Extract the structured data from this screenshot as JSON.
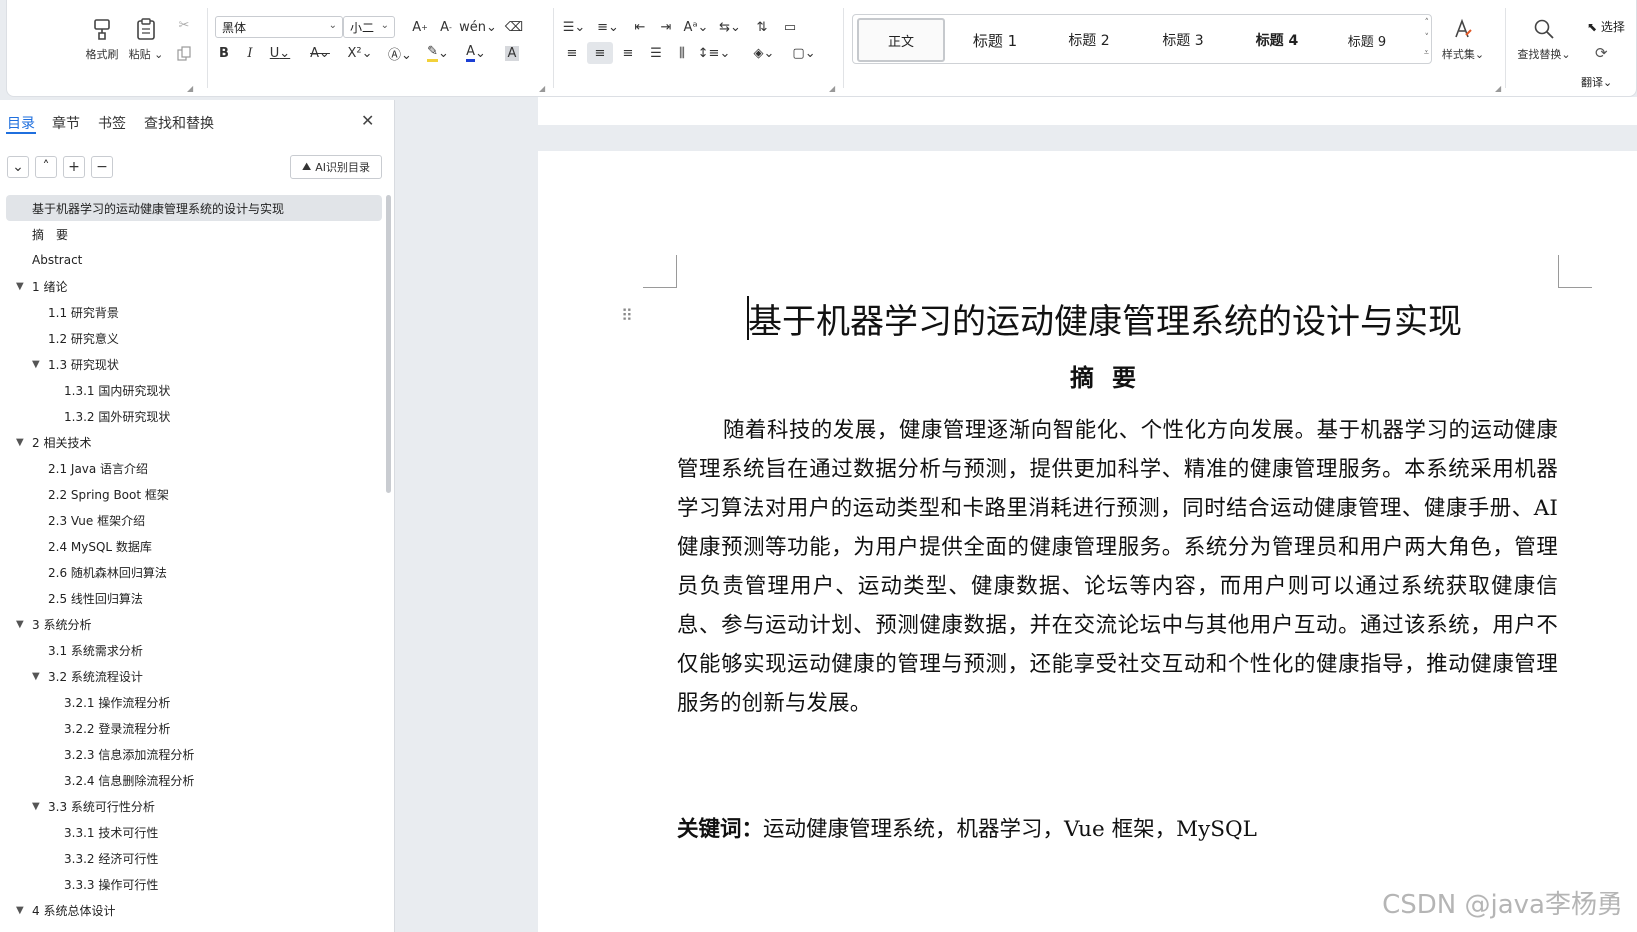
{
  "ribbon": {
    "format_painter": "格式刷",
    "paste": "粘贴",
    "font_name": "黑体",
    "font_size": "小二",
    "styles": [
      {
        "label": "正文"
      },
      {
        "label": "标题 1"
      },
      {
        "label": "标题 2"
      },
      {
        "label": "标题 3"
      },
      {
        "label": "标题 4"
      },
      {
        "label": "标题 9"
      }
    ],
    "style_set": "样式集",
    "find_replace": "查找替换",
    "select": "选择",
    "translate": "翻译",
    "bold": "B",
    "italic": "I",
    "underline": "U",
    "strike": "A",
    "superscript": "X²",
    "font_color_letter": "A",
    "char_shading": "A"
  },
  "nav": {
    "tabs": [
      "目录",
      "章节",
      "书签",
      "查找和替换"
    ],
    "ai_button": "AI识别目录",
    "toc": [
      {
        "text": "基于机器学习的运动健康管理系统的设计与实现",
        "level": 0,
        "selected": true
      },
      {
        "text": "摘　要",
        "level": 0
      },
      {
        "text": "Abstract",
        "level": 0
      },
      {
        "text": "1  绪论",
        "level": 0,
        "expanded": true
      },
      {
        "text": "1.1  研究背景",
        "level": 1
      },
      {
        "text": "1.2  研究意义",
        "level": 1
      },
      {
        "text": "1.3  研究现状",
        "level": 1,
        "expanded": true
      },
      {
        "text": "1.3.1  国内研究现状",
        "level": 2
      },
      {
        "text": "1.3.2  国外研究现状",
        "level": 2
      },
      {
        "text": "2  相关技术",
        "level": 0,
        "expanded": true
      },
      {
        "text": "2.1 Java 语言介绍",
        "level": 1
      },
      {
        "text": "2.2 Spring Boot 框架",
        "level": 1
      },
      {
        "text": "2.3 Vue 框架介绍",
        "level": 1
      },
      {
        "text": "2.4 MySQL 数据库",
        "level": 1
      },
      {
        "text": "2.6  随机森林回归算法",
        "level": 1
      },
      {
        "text": "2.5  线性回归算法",
        "level": 1
      },
      {
        "text": "3  系统分析",
        "level": 0,
        "expanded": true
      },
      {
        "text": "3.1  系统需求分析",
        "level": 1
      },
      {
        "text": "3.2  系统流程设计",
        "level": 1,
        "expanded": true
      },
      {
        "text": "3.2.1 操作流程分析",
        "level": 2
      },
      {
        "text": "3.2.2 登录流程分析",
        "level": 2
      },
      {
        "text": "3.2.3 信息添加流程分析",
        "level": 2
      },
      {
        "text": "3.2.4 信息删除流程分析",
        "level": 2
      },
      {
        "text": "3.3  系统可行性分析",
        "level": 1,
        "expanded": true
      },
      {
        "text": "3.3.1  技术可行性",
        "level": 2
      },
      {
        "text": "3.3.2  经济可行性",
        "level": 2
      },
      {
        "text": "3.3.3  操作可行性",
        "level": 2
      },
      {
        "text": "4  系统总体设计",
        "level": 0,
        "expanded": true
      }
    ]
  },
  "document": {
    "title": "基于机器学习的运动健康管理系统的设计与实现",
    "abstract_heading": "摘要",
    "abstract_body": "随着科技的发展，健康管理逐渐向智能化、个性化方向发展。基于机器学习的运动健康管理系统旨在通过数据分析与预测，提供更加科学、精准的健康管理服务。本系统采用机器学习算法对用户的运动类型和卡路里消耗进行预测，同时结合运动健康管理、健康手册、AI 健康预测等功能，为用户提供全面的健康管理服务。系统分为管理员和用户两大角色，管理员负责管理用户、运动类型、健康数据、论坛等内容，而用户则可以通过系统获取健康信息、参与运动计划、预测健康数据，并在交流论坛中与其他用户互动。通过该系统，用户不仅能够实现运动健康的管理与预测，还能享受社交互动和个性化的健康指导，推动健康管理服务的创新与发展。",
    "keywords_label": "关键词：",
    "keywords": "运动健康管理系统，机器学习，Vue 框架，MySQL"
  },
  "watermark": "CSDN @java李杨勇"
}
